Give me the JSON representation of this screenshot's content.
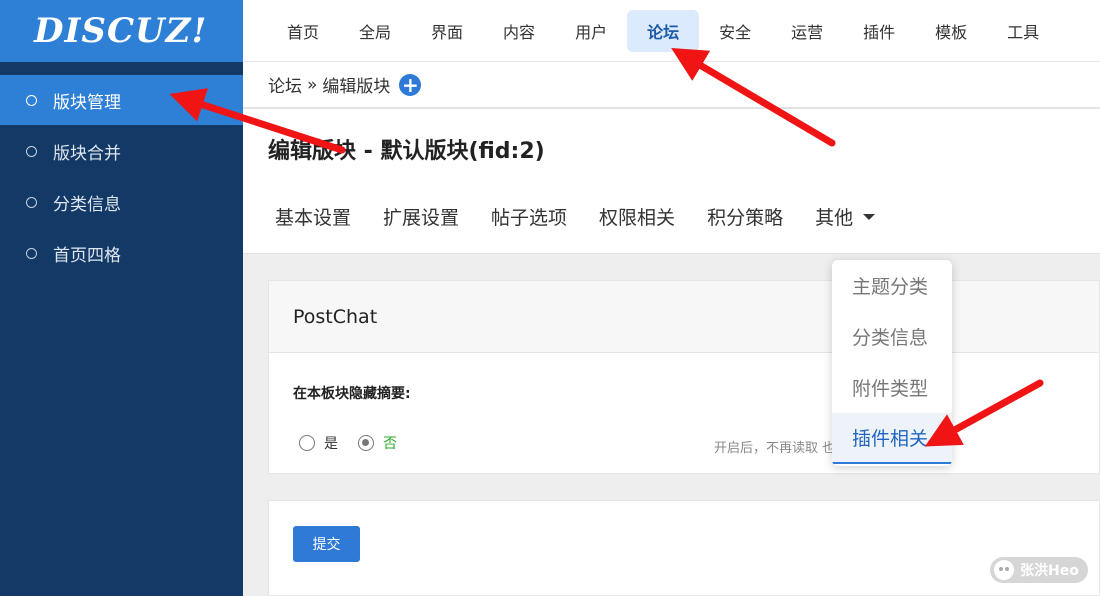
{
  "logo": "DISCUZ!",
  "sidebar": {
    "items": [
      {
        "label": "版块管理"
      },
      {
        "label": "版块合并"
      },
      {
        "label": "分类信息"
      },
      {
        "label": "首页四格"
      }
    ],
    "active_index": 0
  },
  "topnav": {
    "items": [
      "首页",
      "全局",
      "界面",
      "内容",
      "用户",
      "论坛",
      "安全",
      "运营",
      "插件",
      "模板",
      "工具"
    ],
    "active_index": 5
  },
  "breadcrumb": {
    "root": "论坛",
    "separator": "»",
    "current": "编辑版块",
    "add_icon": "plus-circle-icon"
  },
  "page": {
    "title": "编辑版块 - 默认版块(fid:2)",
    "tabs": [
      "基本设置",
      "扩展设置",
      "帖子选项",
      "权限相关",
      "积分策略"
    ],
    "more_tab": "其他"
  },
  "dropdown": {
    "items": [
      "主题分类",
      "分类信息",
      "附件类型",
      "插件相关"
    ],
    "active_index": 3
  },
  "card": {
    "header": "PostChat",
    "field_label": "在本板块隐藏摘要:",
    "option_yes": "是",
    "option_no": "否",
    "selected": "否",
    "hint": "开启后，不再读取                                    也不在这个板块展示内"
  },
  "submit_label": "提交",
  "watermark": "张洪Heo",
  "colors": {
    "sidebar_bg": "#133967",
    "accent": "#2e80d6",
    "arrow": "#f01414"
  }
}
